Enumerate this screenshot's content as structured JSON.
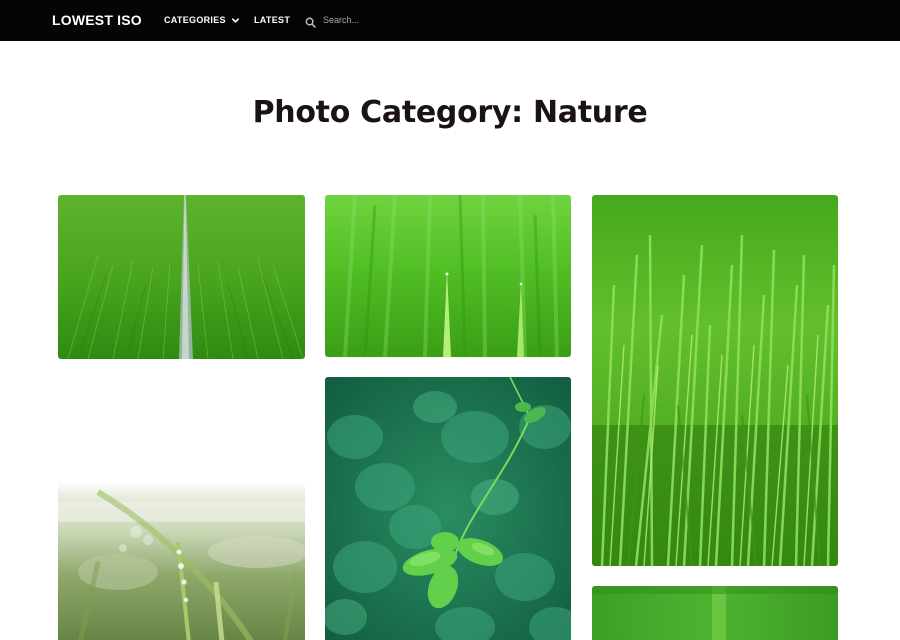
{
  "header": {
    "logo": "LOWEST ISO",
    "nav": [
      {
        "label": "CATEGORIES",
        "has_dropdown": true,
        "icon": "chevron-down-icon"
      },
      {
        "label": "LATEST"
      }
    ],
    "search": {
      "placeholder": "Search...",
      "icon": "search-icon"
    }
  },
  "page": {
    "title": "Photo Category: Nature"
  },
  "gallery": {
    "photos": [
      {
        "subject": "rice-field-with-path"
      },
      {
        "subject": "grass-closeup"
      },
      {
        "subject": "tall-rice-grass"
      },
      {
        "subject": "clover-leaves"
      },
      {
        "subject": "dew-drops-on-grass"
      },
      {
        "subject": "green-blur"
      }
    ]
  },
  "colors": {
    "navbar_bg": "#050505",
    "nav_text": "#ffffff",
    "title_text": "#1b1212",
    "page_bg": "#ffffff"
  }
}
